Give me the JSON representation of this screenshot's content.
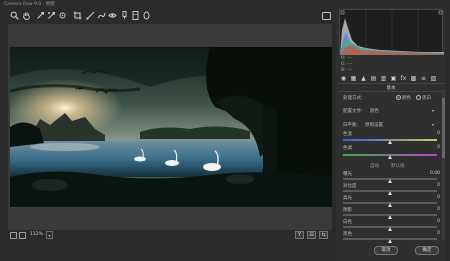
{
  "window": {
    "title": "Camera Raw 9.0 - 原图"
  },
  "toolbar": {
    "tools": [
      {
        "icon": "zoom-icon"
      },
      {
        "icon": "hand-icon"
      },
      {
        "icon": "white-balance-icon"
      },
      {
        "icon": "color-sampler-icon"
      },
      {
        "icon": "target-adjust-icon"
      },
      {
        "icon": "crop-icon"
      },
      {
        "icon": "straighten-icon"
      },
      {
        "icon": "spot-removal-icon"
      },
      {
        "icon": "red-eye-icon"
      },
      {
        "icon": "adjustment-brush-icon"
      },
      {
        "icon": "graduated-filter-icon"
      },
      {
        "icon": "radial-filter-icon"
      }
    ],
    "right_icon": "open-preferences-icon"
  },
  "preview": {
    "zoom_level": "112%",
    "view_toggle_label": "Y"
  },
  "histogram": {
    "info": [
      "R: ---",
      "G: ---",
      "B: ---"
    ]
  },
  "panel": {
    "tabs": [
      "basic-icon",
      "tone-curve-icon",
      "detail-icon",
      "hsl-icon",
      "split-toning-icon",
      "lens-icon",
      "effects-icon",
      "camera-calibration-icon",
      "presets-icon",
      "snapshots-icon"
    ],
    "section_title": "基本",
    "treatment_label": "处理方式:",
    "treatment_color": "颜色",
    "treatment_bw": "黑白",
    "profile_label": "配置文件:",
    "profile_value": "颜色",
    "wb_label": "白平衡:",
    "wb_value": "原照设置",
    "auto_label": "自动",
    "default_label": "默认值",
    "sliders": [
      {
        "label": "色温",
        "value": "0",
        "pos": 0.5
      },
      {
        "label": "色调",
        "value": "0",
        "pos": 0.5
      },
      {
        "label": "曝光",
        "value": "0.00",
        "pos": 0.5
      },
      {
        "label": "对比度",
        "value": "0",
        "pos": 0.5
      },
      {
        "label": "高光",
        "value": "0",
        "pos": 0.5
      },
      {
        "label": "阴影",
        "value": "0",
        "pos": 0.5
      },
      {
        "label": "白色",
        "value": "0",
        "pos": 0.5
      },
      {
        "label": "黑色",
        "value": "0",
        "pos": 0.5
      }
    ]
  },
  "buttons": {
    "cancel": "取消",
    "ok": "确定"
  }
}
